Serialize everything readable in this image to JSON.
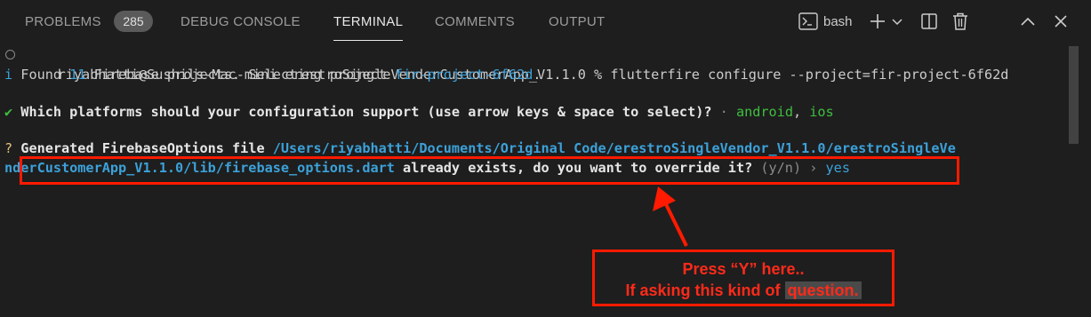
{
  "tabs": [
    {
      "label": "PROBLEMS",
      "badge": "285"
    },
    {
      "label": "DEBUG CONSOLE"
    },
    {
      "label": "TERMINAL"
    },
    {
      "label": "COMMENTS"
    },
    {
      "label": "OUTPUT"
    }
  ],
  "actions": {
    "shell_label": "bash",
    "terminal_icon": "terminal-icon",
    "add_icon": "plus-icon",
    "dropdown_icon": "chevron-down-icon",
    "split_icon": "split-editor-icon",
    "trash_icon": "trash-icon",
    "maximize_icon": "chevron-up-icon",
    "close_icon": "close-icon"
  },
  "terminal": {
    "line1": "riyabhatti@Sushils-Mac-mini erestroSingleVenderCustomerApp_V1.1.0 % flutterfire configure --project=fir-project-6f62d",
    "line2_prefix": "i",
    "line2_a": " Found ",
    "line2_count": "11",
    "line2_b": " Firebase projects. Selecting project ",
    "line2_project": "fir-project-6f62d",
    "line2_end": ".",
    "line3_check": "✔",
    "line3_question": " Which platforms should your configuration support (use arrow keys & space to select)? ",
    "line3_sep": "·",
    "line3_answer_a": " android",
    "line3_comma": ", ",
    "line3_answer_b": "ios",
    "line4_q": "?",
    "line4_text": " Generated FirebaseOptions file ",
    "line4_path": "/Users/riyabhatti/Documents/Original Code/erestroSingleVendor_V1.1.0/erestroSingleVe",
    "line5_path": "nderCustomerApp_V1.1.0/lib/firebase_options.dart",
    "line5_text": " already exists, do you want to override it? ",
    "line5_hint": "(y/n) ›",
    "line5_answer": " yes"
  },
  "annotation": {
    "line1": "Press “Y”  here..",
    "line2_a": "If asking this kind of ",
    "line2_b": "question."
  },
  "colors": {
    "annotation_red": "#ff1a00",
    "link_cyan": "#3ca1d9",
    "answer_green": "#3fbf3f"
  }
}
